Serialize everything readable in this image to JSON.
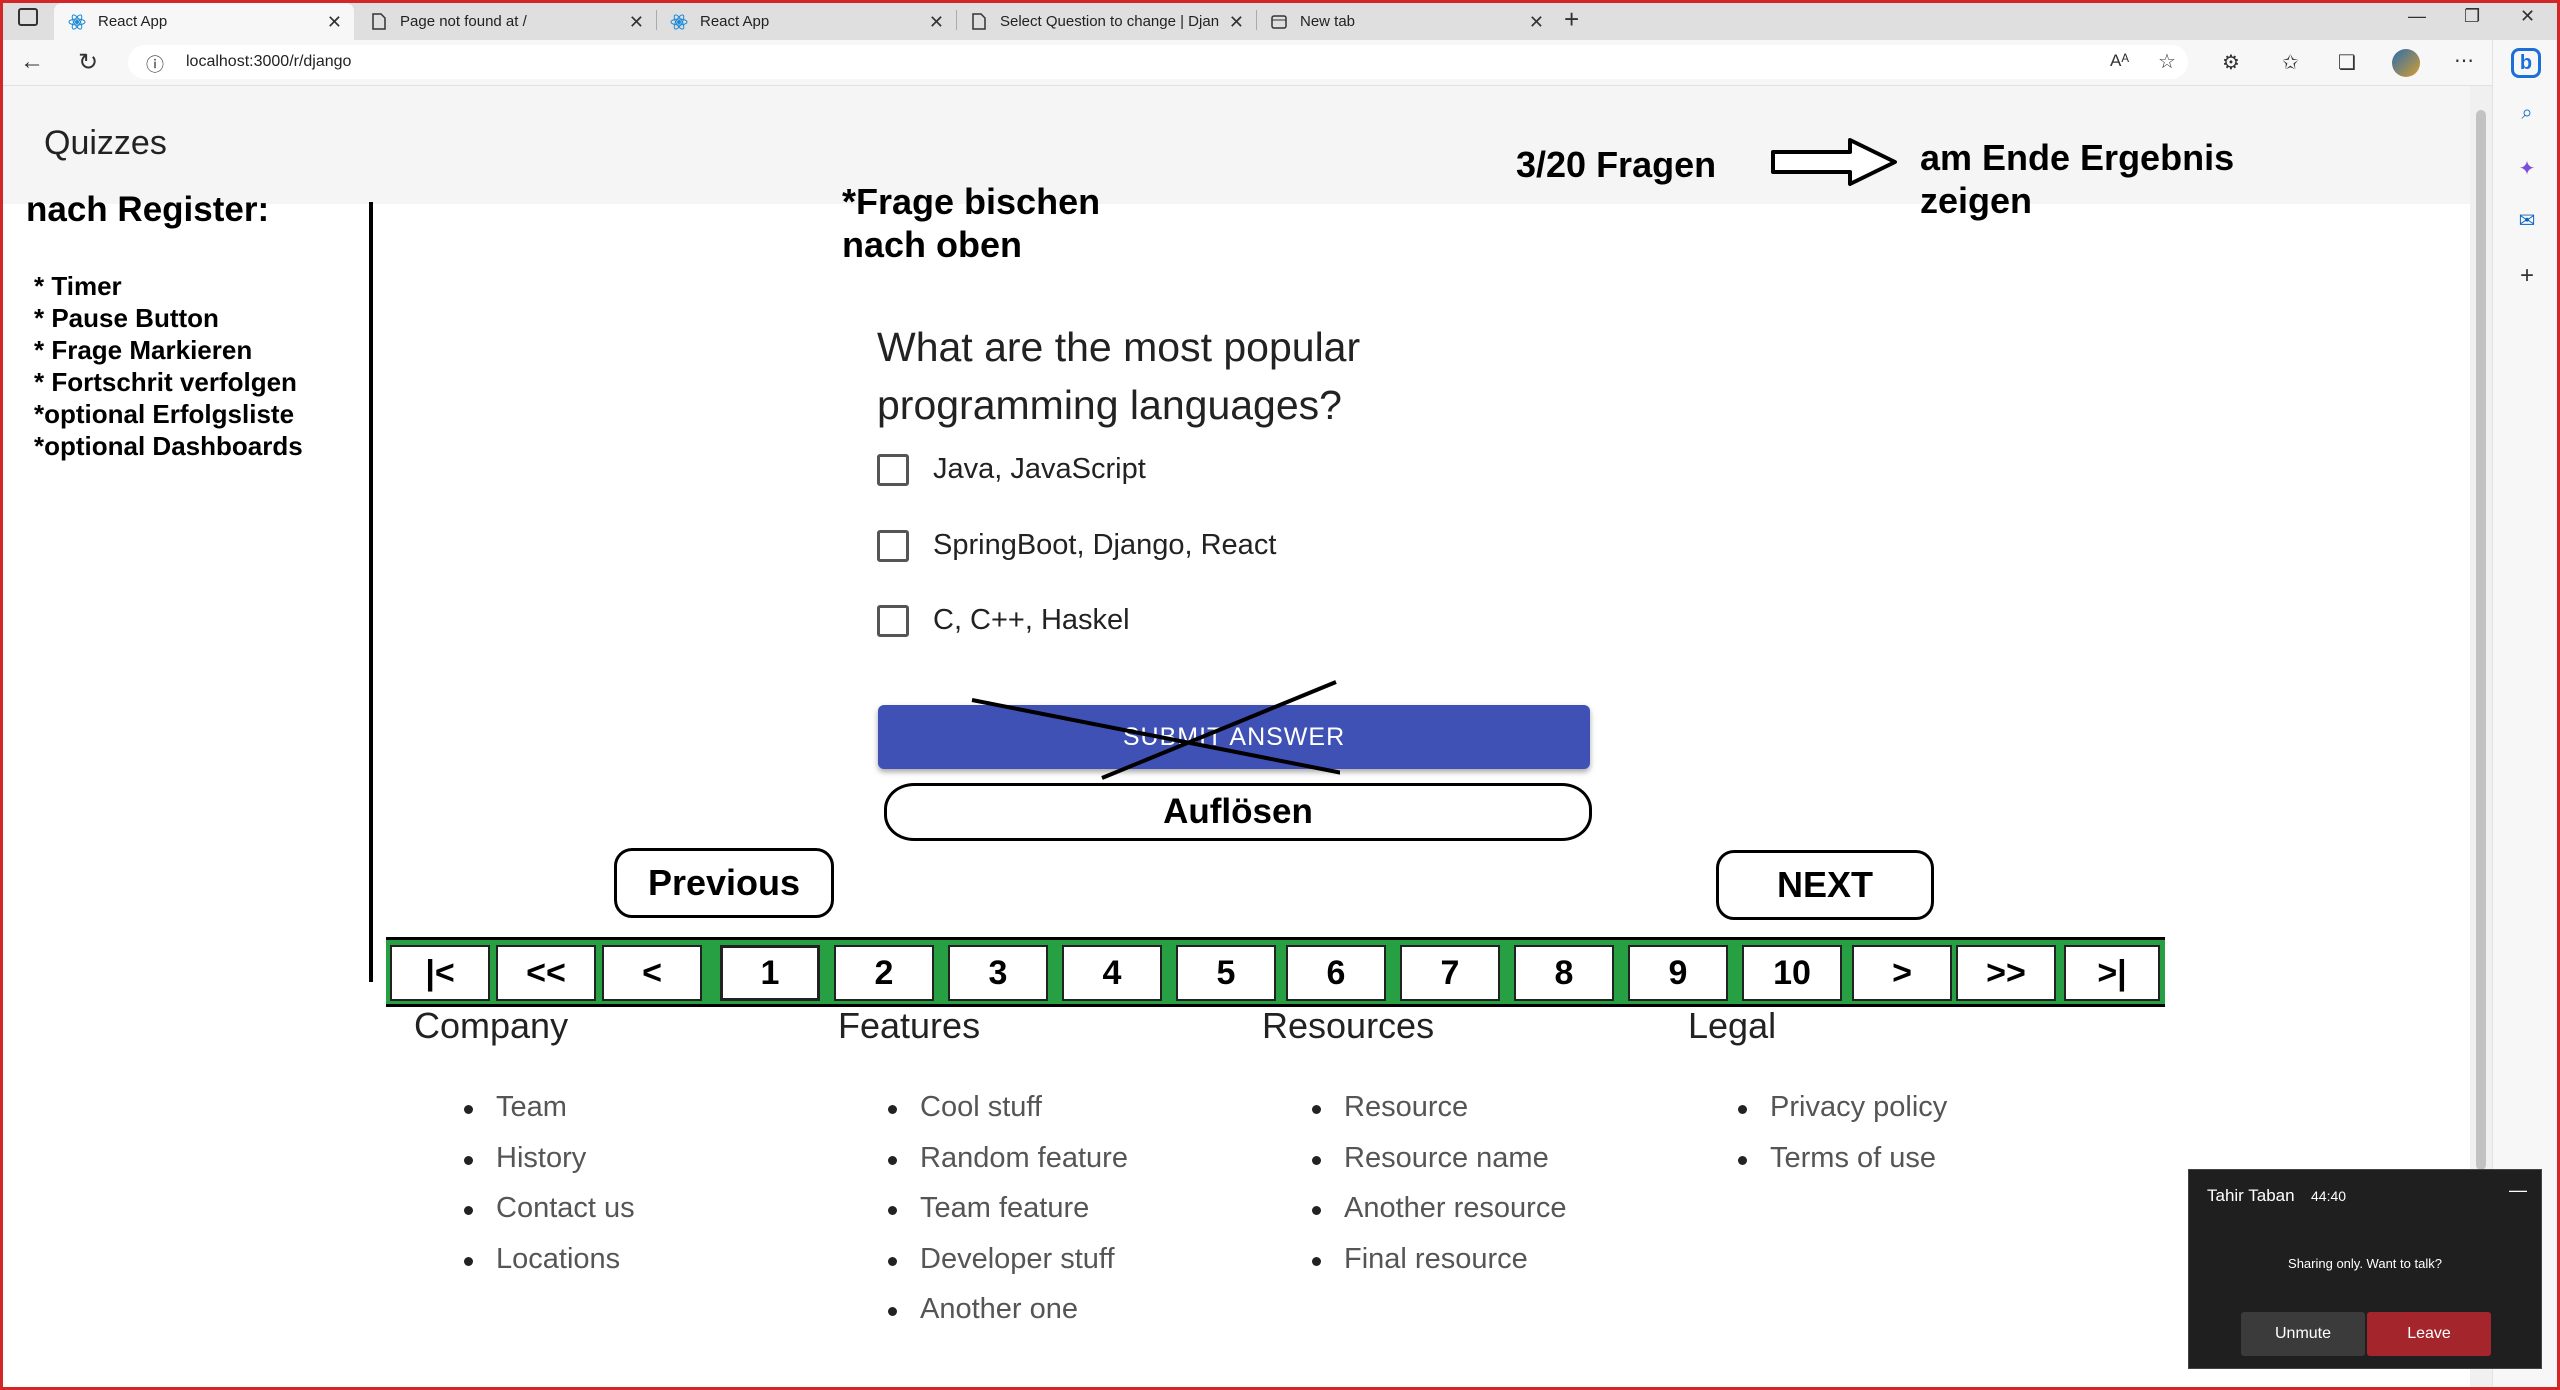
{
  "browser": {
    "tabs": [
      {
        "title": "React App",
        "active": true
      },
      {
        "title": "Page not found at /",
        "active": false
      },
      {
        "title": "React App",
        "active": false
      },
      {
        "title": "Select Question to change | Djan",
        "active": false
      },
      {
        "title": "New tab",
        "active": false
      }
    ],
    "url": "localhost:3000/r/django"
  },
  "app": {
    "title": "Quizzes"
  },
  "annotations": {
    "sidebar_title": "nach Register:",
    "sidebar_items": [
      "* Timer",
      "* Pause Button",
      "* Frage Markieren",
      "* Fortschrit verfolgen",
      "*optional Erfolgsliste",
      "*optional Dashboards"
    ],
    "frage_note_1": "*Frage bischen",
    "frage_note_2": "nach oben",
    "progress": "3/20 Fragen",
    "end_note_1": "am Ende Ergebnis",
    "end_note_2": "zeigen",
    "resolve": "Auflösen",
    "previous": "Previous",
    "next": "NEXT"
  },
  "quiz": {
    "question": "What are the most popular programming languages?",
    "options": [
      "Java, JavaScript",
      "SpringBoot, Django, React",
      "C, C++, Haskel"
    ],
    "submit_label": "SUBMIT ANSWER"
  },
  "pagination": [
    "|<",
    "<<",
    "<",
    "1",
    "2",
    "3",
    "4",
    "5",
    "6",
    "7",
    "8",
    "9",
    "10",
    ">",
    ">>",
    ">|"
  ],
  "footer": {
    "columns": [
      {
        "heading": "Company",
        "items": [
          "Team",
          "History",
          "Contact us",
          "Locations"
        ]
      },
      {
        "heading": "Features",
        "items": [
          "Cool stuff",
          "Random feature",
          "Team feature",
          "Developer stuff",
          "Another one"
        ]
      },
      {
        "heading": "Resources",
        "items": [
          "Resource",
          "Resource name",
          "Another resource",
          "Final resource"
        ]
      },
      {
        "heading": "Legal",
        "items": [
          "Privacy policy",
          "Terms of use"
        ]
      }
    ]
  },
  "teams_popup": {
    "name": "Tahir Taban",
    "time": "44:40",
    "message": "Sharing only. Want to talk?",
    "unmute": "Unmute",
    "leave": "Leave"
  },
  "colors": {
    "accent": "#3f51b5",
    "pagination_bg": "#27a043",
    "leave": "#a4262c"
  }
}
